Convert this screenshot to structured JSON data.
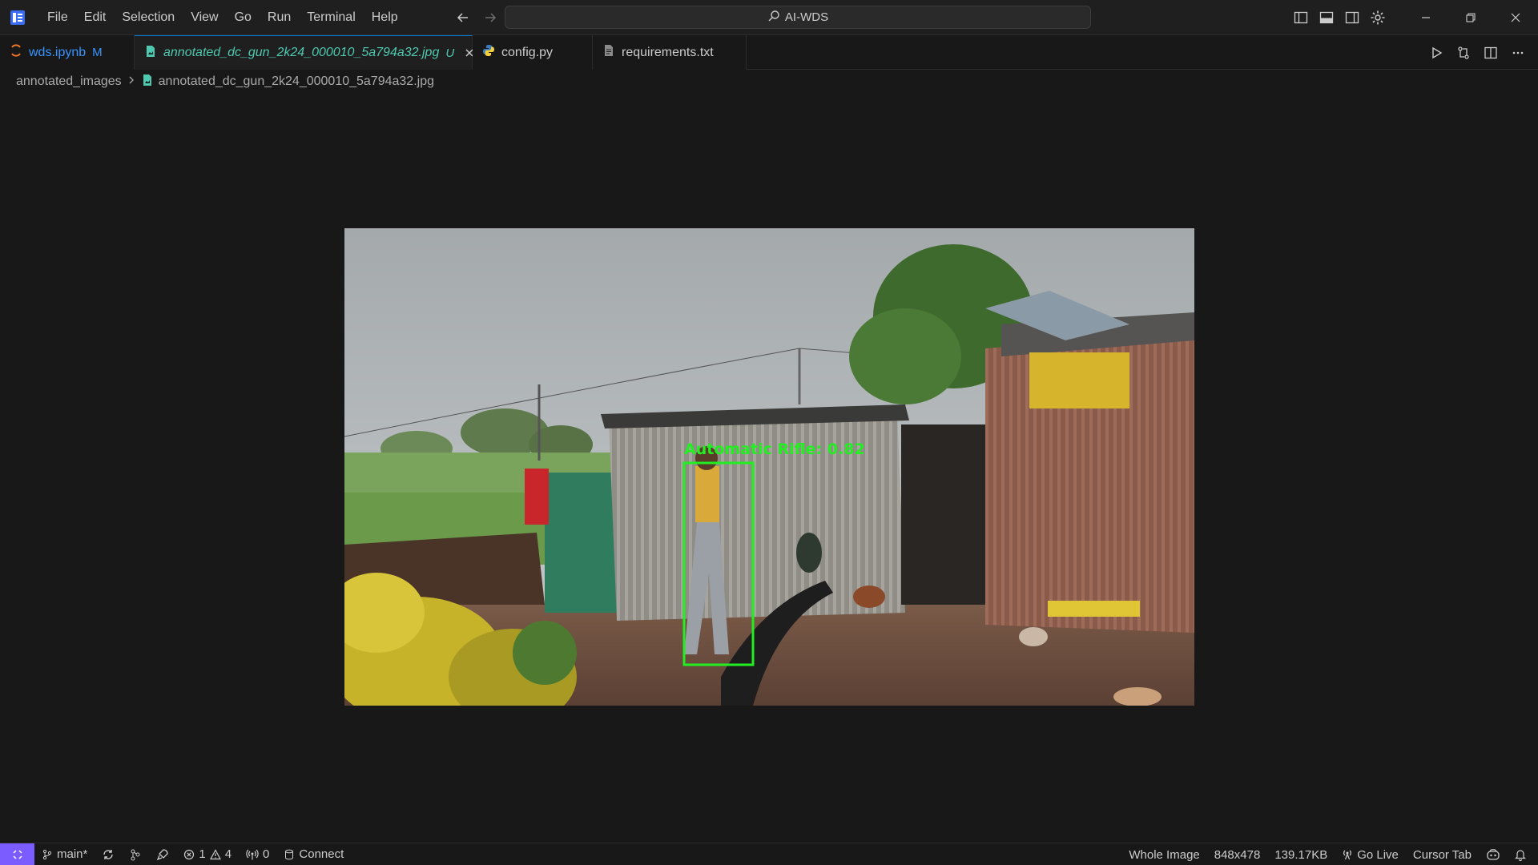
{
  "menu": [
    "File",
    "Edit",
    "Selection",
    "View",
    "Go",
    "Run",
    "Terminal",
    "Help"
  ],
  "search": {
    "text": "AI-WDS"
  },
  "tabs": [
    {
      "label": "wds.ipynb",
      "mark": "M",
      "icon": "notebook-icon",
      "color": "#3794ff"
    },
    {
      "label": "annotated_dc_gun_2k24_000010_5a794a32.jpg",
      "mark": "U",
      "icon": "image-file-icon",
      "color": "#4ec9b0"
    },
    {
      "label": "config.py",
      "mark": "",
      "icon": "python-icon",
      "color": "#cccccc"
    },
    {
      "label": "requirements.txt",
      "mark": "",
      "icon": "text-file-icon",
      "color": "#cccccc"
    }
  ],
  "breadcrumb": {
    "folder": "annotated_images",
    "file": "annotated_dc_gun_2k24_000010_5a794a32.jpg"
  },
  "image": {
    "detection_label": "Automatic Rifle: 0.82",
    "box_color": "#22ee22"
  },
  "statusbar": {
    "branch": "main*",
    "errors": "1",
    "warnings": "4",
    "ports": "0",
    "connect": "Connect",
    "zoom": "Whole Image",
    "dimensions": "848x478",
    "size": "139.17KB",
    "go_live": "Go Live",
    "cursor_tab": "Cursor Tab"
  },
  "colors": {
    "accent": "#0078d4",
    "remote": "#7a5cff",
    "background": "#181818"
  }
}
